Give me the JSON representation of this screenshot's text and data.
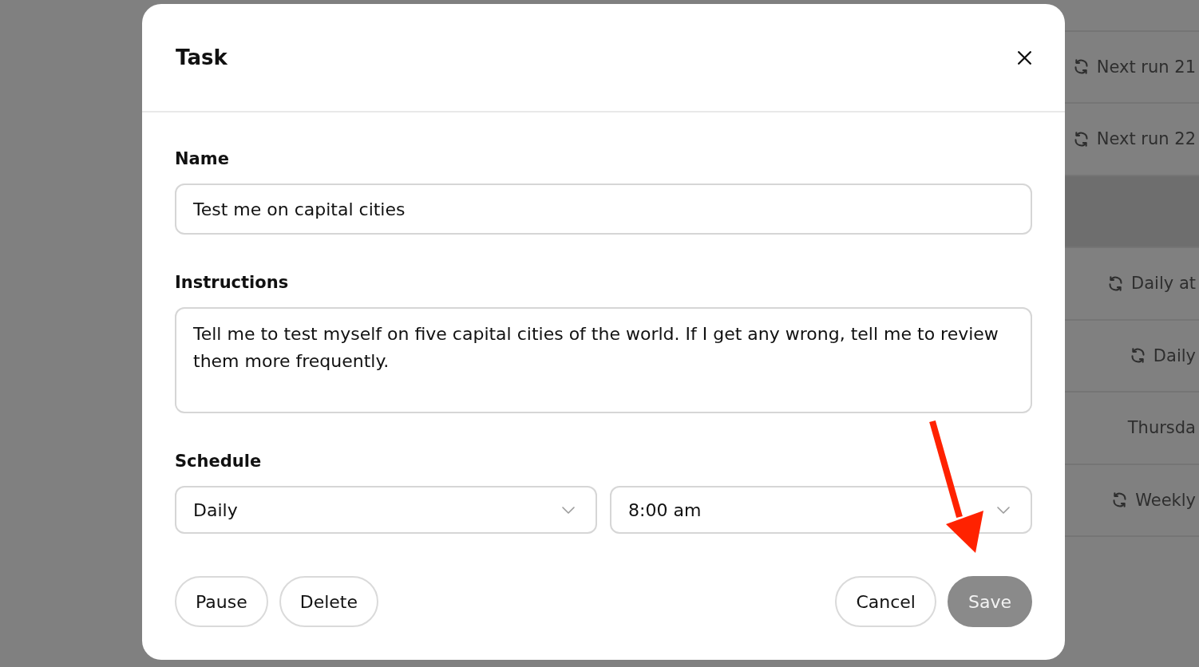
{
  "background": {
    "rows": [
      {
        "highlighted": false
      },
      {
        "schedule": "Next run 21",
        "repeating": true,
        "highlighted": false
      },
      {
        "schedule": "Next run 22",
        "repeating": true,
        "highlighted": false
      },
      {
        "repeating": false,
        "highlighted": true
      },
      {
        "schedule": "Daily at",
        "repeating": true,
        "highlighted": false
      },
      {
        "schedule": "Daily",
        "repeating": true,
        "highlighted": false
      },
      {
        "schedule": "Thursda",
        "repeating": false,
        "highlighted": false
      },
      {
        "schedule": "Weekly",
        "repeating": true,
        "highlighted": false
      }
    ]
  },
  "dialog": {
    "title": "Task",
    "fields": [
      {
        "kind": "text",
        "label": "Name",
        "value": "Test me on capital cities"
      },
      {
        "kind": "textarea",
        "label": "Instructions",
        "value": "Tell me to test myself on five capital cities of the world. If I get any wrong, tell me to review them more frequently."
      },
      {
        "kind": "selects",
        "label": "Schedule",
        "options": [
          {
            "value": "Daily"
          },
          {
            "value": "8:00 am"
          }
        ]
      }
    ],
    "left_buttons": [
      {
        "label": "Pause"
      },
      {
        "label": "Delete"
      }
    ],
    "right_buttons": [
      {
        "label": "Cancel",
        "kind": "secondary",
        "disabled": false
      },
      {
        "label": "Save",
        "kind": "primary",
        "disabled": true
      }
    ]
  }
}
